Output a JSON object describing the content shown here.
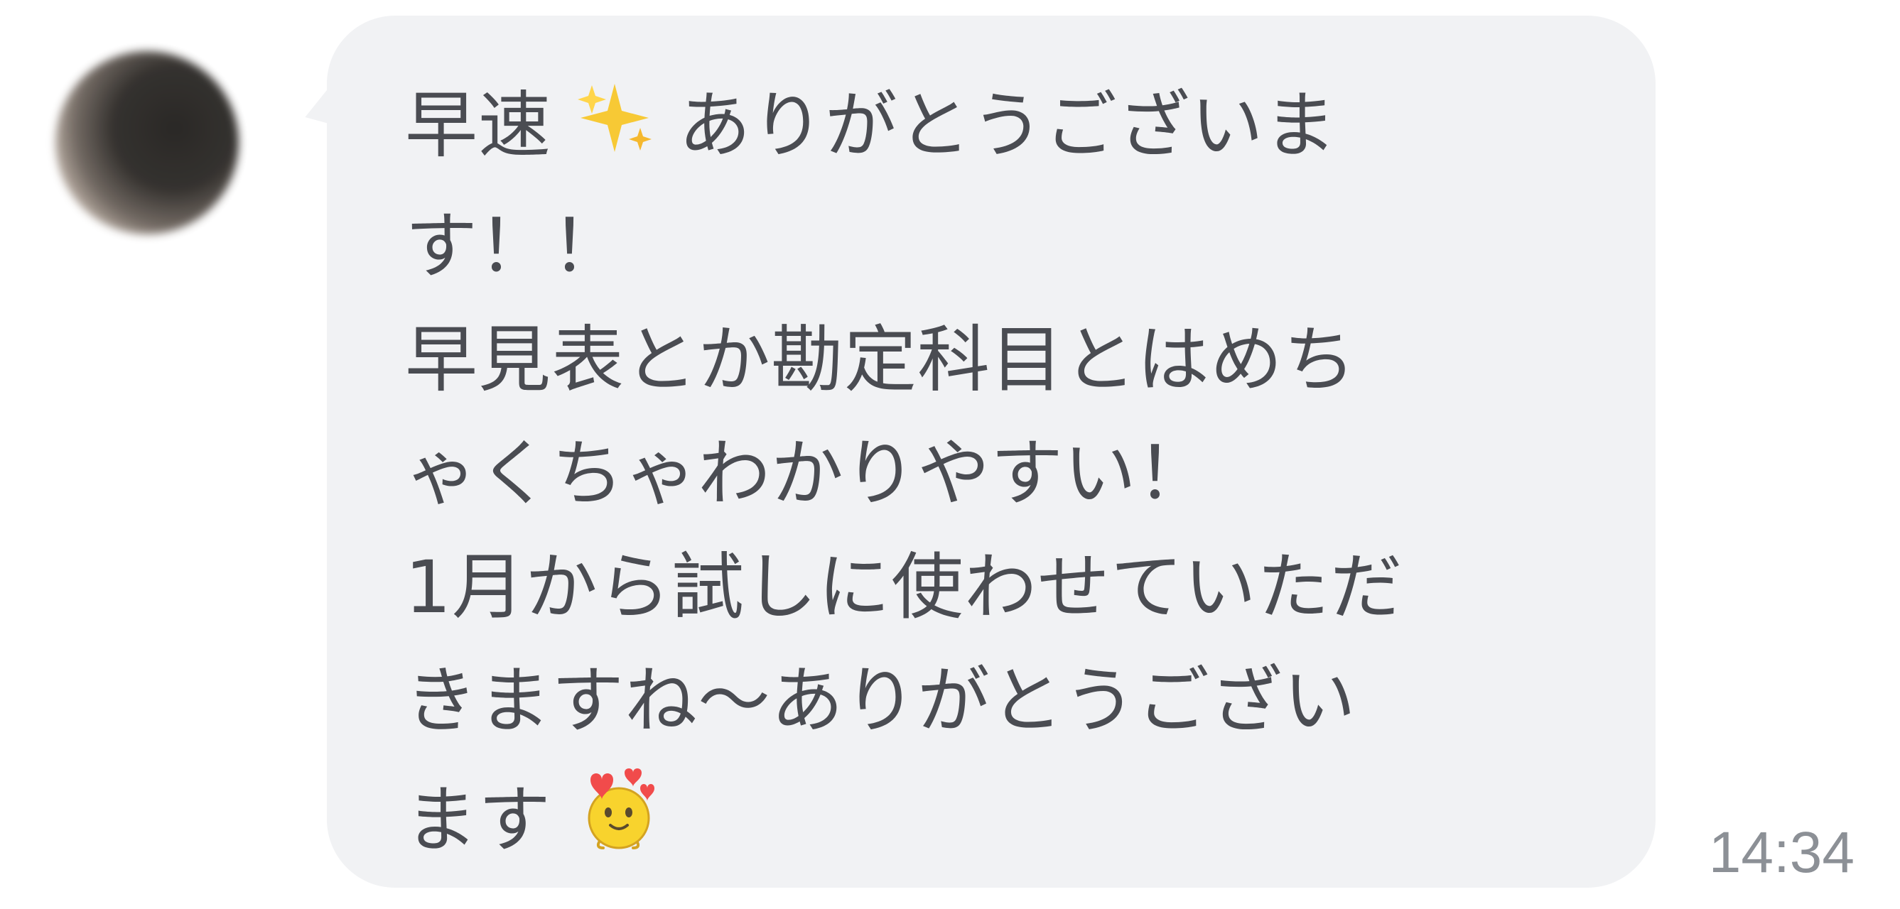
{
  "chat": {
    "message": {
      "lines": [
        "早速",
        "ありがとうございま",
        "す！！",
        "早見表とか勘定科目とはめち",
        "ゃくちゃわかりやすい！",
        "1月から試しに使わせていただ",
        "きますね〜ありがとうござい",
        "ます"
      ],
      "emoji": {
        "sparkles": "sparkles-emoji",
        "face": "love-face-emoji"
      }
    },
    "timestamp": "14:34"
  },
  "colors": {
    "bubble": "#f1f2f4",
    "text": "#4a4c52",
    "timestamp": "#8c9096"
  }
}
